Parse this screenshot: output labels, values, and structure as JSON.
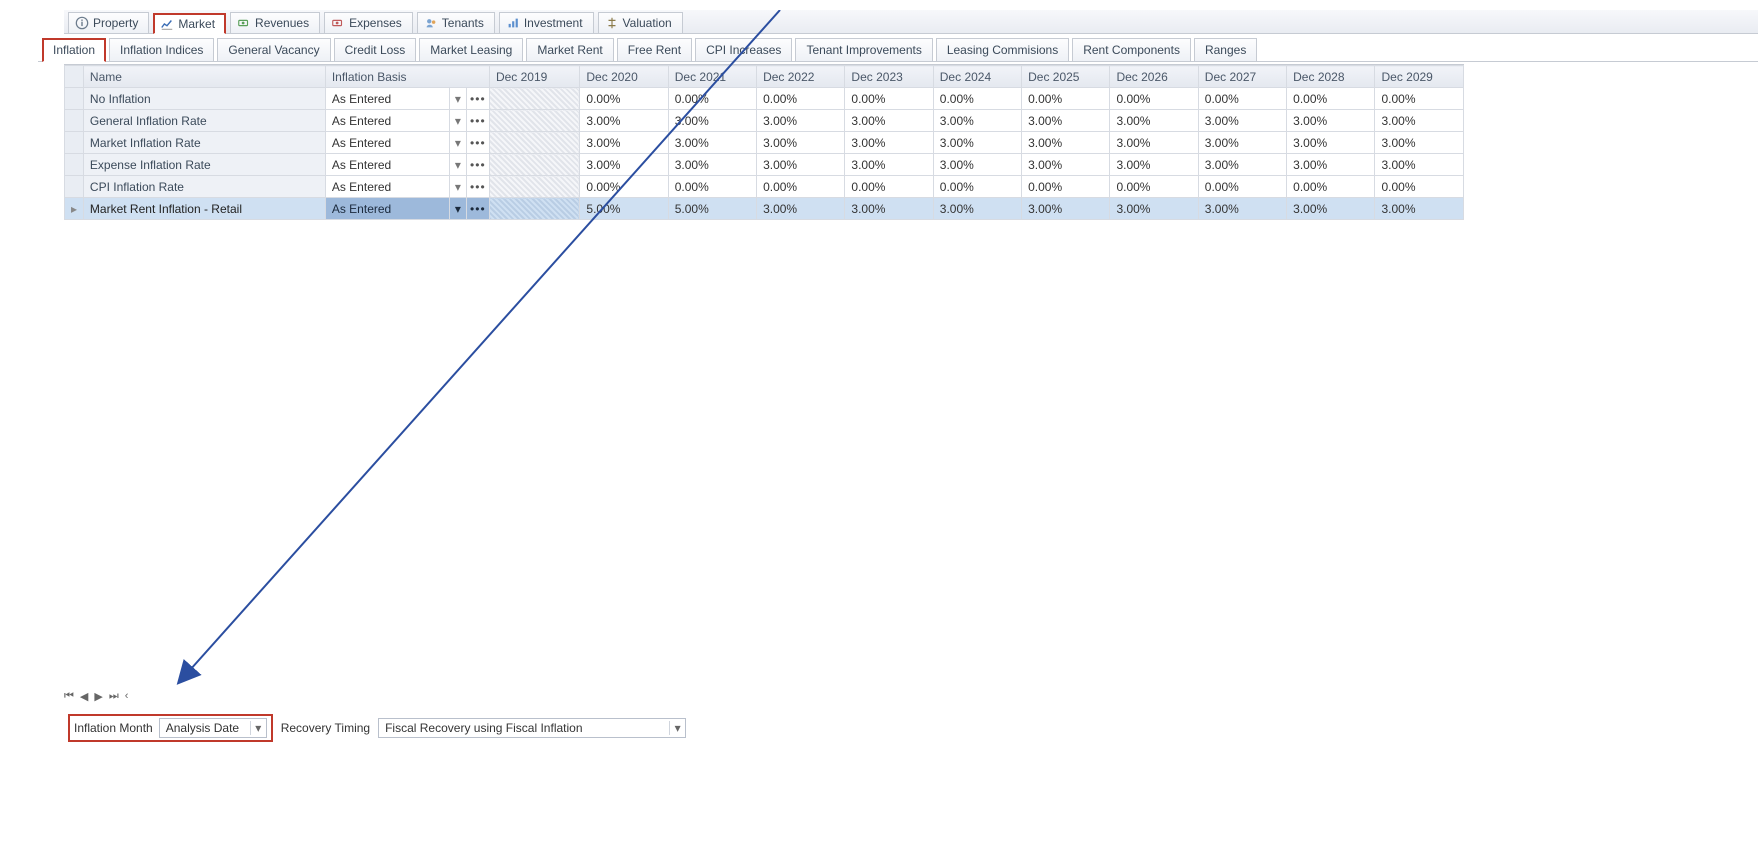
{
  "maintabs": [
    {
      "label": "Property"
    },
    {
      "label": "Market"
    },
    {
      "label": "Revenues"
    },
    {
      "label": "Expenses"
    },
    {
      "label": "Tenants"
    },
    {
      "label": "Investment"
    },
    {
      "label": "Valuation"
    }
  ],
  "subtabs": [
    "Inflation",
    "Inflation Indices",
    "General Vacancy",
    "Credit Loss",
    "Market Leasing",
    "Market Rent",
    "Free Rent",
    "CPI Increases",
    "Tenant Improvements",
    "Leasing Commisions",
    "Rent Components",
    "Ranges"
  ],
  "columns": [
    "Name",
    "Inflation Basis",
    "Dec 2019",
    "Dec 2020",
    "Dec 2021",
    "Dec 2022",
    "Dec 2023",
    "Dec 2024",
    "Dec 2025",
    "Dec 2026",
    "Dec 2027",
    "Dec 2028",
    "Dec 2029"
  ],
  "rows": [
    {
      "name": "No Inflation",
      "basis": "As Entered",
      "vals": [
        "0.00%",
        "0.00%",
        "0.00%",
        "0.00%",
        "0.00%",
        "0.00%",
        "0.00%",
        "0.00%",
        "0.00%",
        "0.00%"
      ]
    },
    {
      "name": "General Inflation Rate",
      "basis": "As Entered",
      "vals": [
        "3.00%",
        "3.00%",
        "3.00%",
        "3.00%",
        "3.00%",
        "3.00%",
        "3.00%",
        "3.00%",
        "3.00%",
        "3.00%"
      ]
    },
    {
      "name": "Market Inflation Rate",
      "basis": "As Entered",
      "vals": [
        "3.00%",
        "3.00%",
        "3.00%",
        "3.00%",
        "3.00%",
        "3.00%",
        "3.00%",
        "3.00%",
        "3.00%",
        "3.00%"
      ]
    },
    {
      "name": "Expense Inflation Rate",
      "basis": "As Entered",
      "vals": [
        "3.00%",
        "3.00%",
        "3.00%",
        "3.00%",
        "3.00%",
        "3.00%",
        "3.00%",
        "3.00%",
        "3.00%",
        "3.00%"
      ]
    },
    {
      "name": "CPI Inflation Rate",
      "basis": "As Entered",
      "vals": [
        "0.00%",
        "0.00%",
        "0.00%",
        "0.00%",
        "0.00%",
        "0.00%",
        "0.00%",
        "0.00%",
        "0.00%",
        "0.00%"
      ]
    },
    {
      "name": "Market Rent Inflation - Retail",
      "basis": "As Entered",
      "selected": true,
      "vals": [
        "5.00%",
        "5.00%",
        "3.00%",
        "3.00%",
        "3.00%",
        "3.00%",
        "3.00%",
        "3.00%",
        "3.00%",
        "3.00%"
      ]
    }
  ],
  "nav": {
    "first": "⏮",
    "prev": "◀",
    "next": "▶",
    "last": "⏭",
    "sep": "‹"
  },
  "footer": {
    "inflation_month_label": "Inflation Month",
    "inflation_month_value": "Analysis Date",
    "recovery_timing_label": "Recovery Timing",
    "recovery_timing_value": "Fiscal Recovery using Fiscal Inflation"
  },
  "glyphs": {
    "chevdown": "▾",
    "dots": "•••",
    "rowsel": "▸"
  }
}
